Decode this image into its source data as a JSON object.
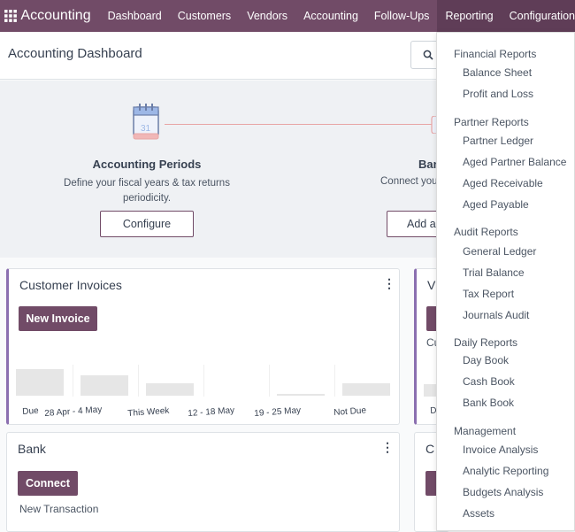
{
  "topbar": {
    "brand": "Accounting",
    "menu": [
      "Dashboard",
      "Customers",
      "Vendors",
      "Accounting",
      "Follow-Ups",
      "Reporting",
      "Configuration"
    ],
    "color": "#714b67",
    "active_color": "#5f3d57"
  },
  "control_panel": {
    "title": "Accounting Dashboard",
    "search_icon": "search-icon"
  },
  "onboarding": {
    "steps": [
      {
        "title": "Accounting Periods",
        "desc_line1": "Define your fiscal years & tax returns",
        "desc_line2": "periodicity.",
        "button": "Configure"
      },
      {
        "title": "Ban",
        "desc": "Connect you",
        "button": "Add a"
      }
    ]
  },
  "cards": {
    "customer_invoices": {
      "title": "Customer Invoices",
      "button": "New Invoice",
      "chart_labels": [
        "Due",
        "28 Apr - 4 May",
        "This Week",
        "12 - 18 May",
        "19 - 25 May",
        "Not Due"
      ]
    },
    "vendor_partial": {
      "title": "V",
      "link": "Cu",
      "tick": "D"
    },
    "bank": {
      "title": "Bank",
      "button": "Connect",
      "link": "New Transaction"
    },
    "cash_partial": {
      "title": "C"
    }
  },
  "chart_data": {
    "type": "bar",
    "categories": [
      "Due",
      "28 Apr - 4 May",
      "This Week",
      "12 - 18 May",
      "19 - 25 May",
      "Not Due"
    ],
    "values": [
      28,
      21,
      13,
      0,
      2,
      13
    ]
  },
  "reporting_menu": {
    "sections": [
      {
        "title": "Financial Reports",
        "items": [
          "Balance Sheet",
          "Profit and Loss"
        ]
      },
      {
        "title": "Partner Reports",
        "items": [
          "Partner Ledger",
          "Aged Partner Balance",
          "Aged Receivable",
          "Aged Payable"
        ]
      },
      {
        "title": "Audit Reports",
        "items": [
          "General Ledger",
          "Trial Balance",
          "Tax Report",
          "Journals Audit"
        ]
      },
      {
        "title": "Daily Reports",
        "items": [
          "Day Book",
          "Cash Book",
          "Bank Book"
        ]
      },
      {
        "title": "Management",
        "items": [
          "Invoice Analysis",
          "Analytic Reporting",
          "Budgets Analysis",
          "Assets"
        ]
      }
    ]
  }
}
